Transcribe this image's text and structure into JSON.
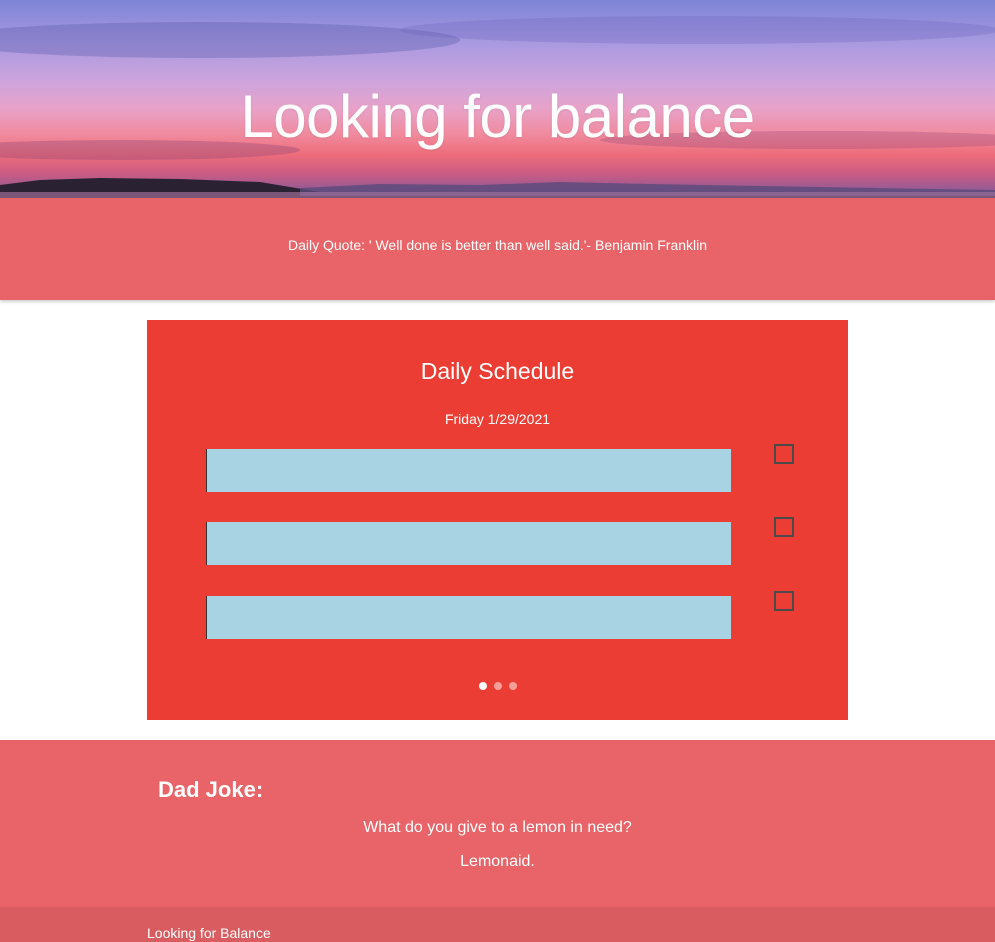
{
  "header": {
    "title": "Looking for balance"
  },
  "quote": {
    "text": "Daily Quote: ' Well done is better than well said.'- Benjamin Franklin"
  },
  "schedule": {
    "title": "Daily Schedule",
    "date": "Friday 1/29/2021",
    "tasks": [
      {
        "value": "",
        "checked": false
      },
      {
        "value": "",
        "checked": false
      },
      {
        "value": "",
        "checked": false
      }
    ],
    "carousel": {
      "slides": 3,
      "active": 1
    }
  },
  "joke": {
    "heading": "Dad Joke:",
    "question": "What do you give to a lemon in need?",
    "answer": "Lemonaid."
  },
  "footer": {
    "text": "Looking for Balance"
  },
  "colors": {
    "quote_band": "#e86468",
    "schedule_card": "#ec3d34",
    "task_input": "#a8d3e2",
    "footer": "#d85c60"
  }
}
